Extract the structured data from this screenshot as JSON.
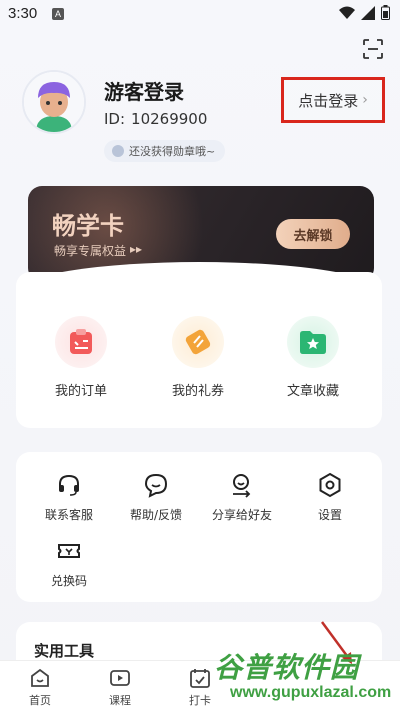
{
  "status_bar": {
    "time": "3:30",
    "notif_letter": "A"
  },
  "user": {
    "name": "游客登录",
    "id_label": "ID:",
    "id_value": "10269900",
    "badge_text": "还没获得勋章哦~"
  },
  "login_button": {
    "label": "点击登录"
  },
  "vip": {
    "title": "畅学卡",
    "subtitle": "畅享专属权益",
    "subtitle_arrow": "▸▸",
    "unlock_label": "去解锁"
  },
  "quick_actions": [
    {
      "label": "我的订单",
      "icon": "order-icon",
      "color": "#f25a5a"
    },
    {
      "label": "我的礼券",
      "icon": "coupon-icon",
      "color": "#f3a43a"
    },
    {
      "label": "文章收藏",
      "icon": "favorites-icon",
      "color": "#2bb673"
    }
  ],
  "services": [
    {
      "label": "联系客服",
      "icon": "headset-icon"
    },
    {
      "label": "帮助/反馈",
      "icon": "help-feedback-icon"
    },
    {
      "label": "分享给好友",
      "icon": "share-icon"
    },
    {
      "label": "设置",
      "icon": "settings-icon"
    },
    {
      "label": "兑换码",
      "icon": "redeem-code-icon"
    }
  ],
  "tools": {
    "title": "实用工具"
  },
  "tabs": [
    {
      "label": "首页",
      "icon": "home-icon"
    },
    {
      "label": "课程",
      "icon": "course-icon"
    },
    {
      "label": "打卡",
      "icon": "checkin-icon"
    }
  ],
  "watermark": {
    "text": "谷普软件园",
    "url": "www.gupuxlazal.com"
  },
  "colors": {
    "highlight_box": "#d9261c",
    "watermark": "#3fa043"
  }
}
